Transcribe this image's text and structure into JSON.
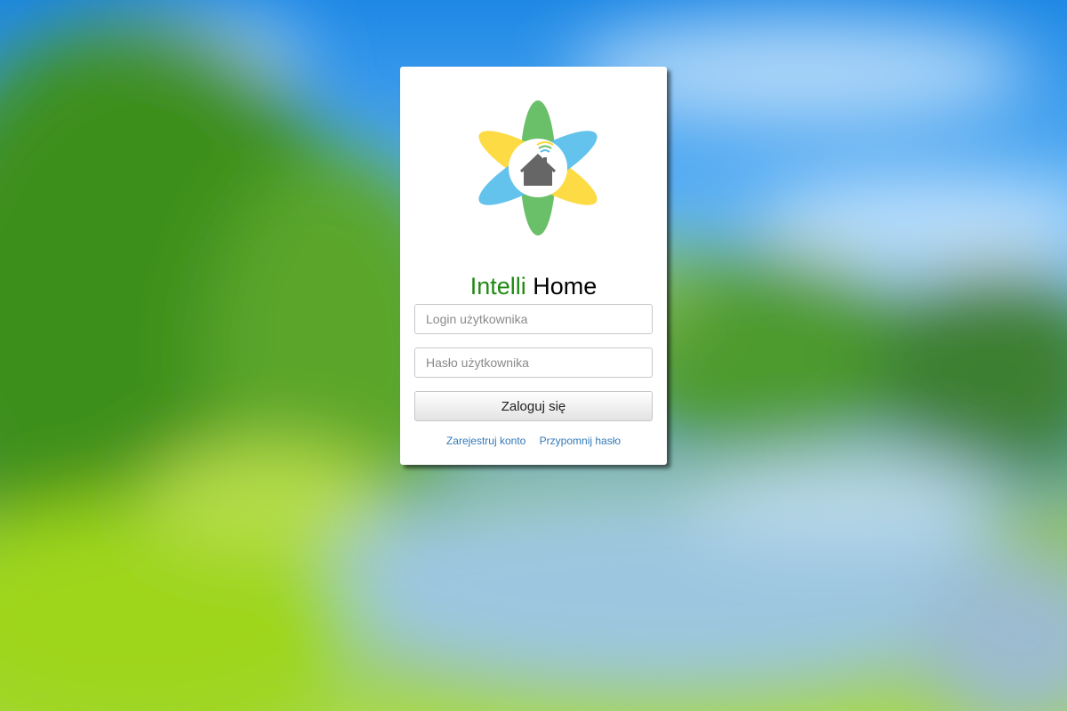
{
  "app": {
    "title_part1": "Intelli",
    "title_part2": "Home",
    "logo_icon": "flower-house-wifi-icon"
  },
  "form": {
    "login_placeholder": "Login użytkownika",
    "password_placeholder": "Hasło użytkownika",
    "login_value": "",
    "password_value": "",
    "submit_label": "Zaloguj się"
  },
  "links": {
    "register": "Zarejestruj konto",
    "remind_password": "Przypomnij hasło"
  },
  "colors": {
    "brand_green": "#1f8a12",
    "petal_green": "#6abf69",
    "petal_yellow": "#fdd835",
    "petal_blue": "#5bc0eb",
    "house_gray": "#666666",
    "link_blue": "#337ab7"
  }
}
